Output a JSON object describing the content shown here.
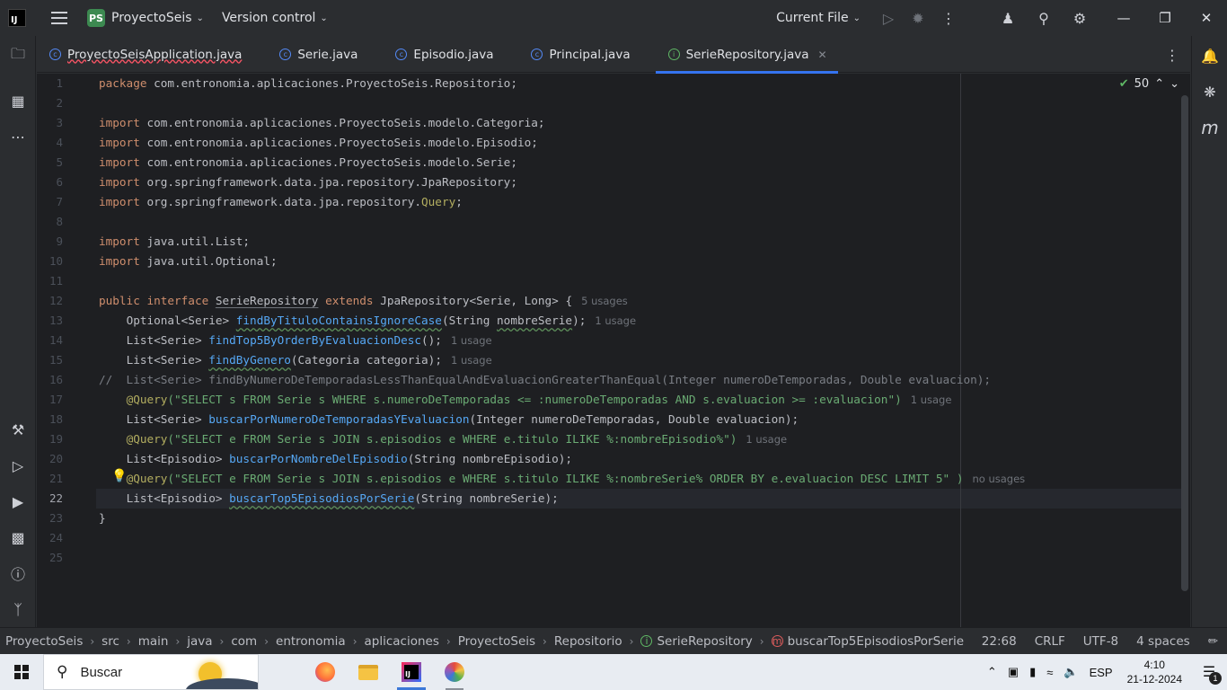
{
  "titlebar": {
    "app_logo": "IJ",
    "project_badge": "PS",
    "project_name": "ProyectoSeis",
    "vcs": "Version control",
    "run_config": "Current File"
  },
  "tabs": [
    {
      "label": "ProyectoSeisApplication.java",
      "kind": "class"
    },
    {
      "label": "Serie.java",
      "kind": "class"
    },
    {
      "label": "Episodio.java",
      "kind": "class"
    },
    {
      "label": "Principal.java",
      "kind": "class"
    },
    {
      "label": "SerieRepository.java",
      "kind": "interface",
      "active": true
    }
  ],
  "editor": {
    "inspection_count": "50",
    "current_line": 22,
    "line_numbers": [
      "1",
      "2",
      "3",
      "4",
      "5",
      "6",
      "7",
      "8",
      "9",
      "10",
      "11",
      "12",
      "13",
      "14",
      "15",
      "16",
      "17",
      "18",
      "19",
      "20",
      "21",
      "22",
      "23",
      "24",
      "25"
    ],
    "hints": {
      "l12": "5 usages",
      "l13": "1 usage",
      "l14": "1 usage",
      "l15": "1 usage",
      "l17": "1 usage",
      "l19": "1 usage",
      "l21": "no usages"
    },
    "code": {
      "l1_kw": "package",
      "l1_rest": " com.entronomia.aplicaciones.ProyectoSeis.Repositorio;",
      "l3": "com.entronomia.aplicaciones.ProyectoSeis.modelo.Categoria;",
      "l4": "com.entronomia.aplicaciones.ProyectoSeis.modelo.Episodio;",
      "l5": "com.entronomia.aplicaciones.ProyectoSeis.modelo.Serie;",
      "l6": "org.springframework.data.jpa.repository.JpaRepository;",
      "l7a": "org.springframework.data.jpa.repository.",
      "l7b": "Query",
      "l9": "java.util.List;",
      "l10": "java.util.Optional;",
      "import_kw": "import",
      "l12_kw1": "public interface",
      "l12_name": "SerieRepository",
      "l12_kw2": "extends",
      "l12_rest": "JpaRepository<Serie, Long> {",
      "l13a": "Optional<Serie> ",
      "l13fn": "findByTituloContainsIgnoreCase",
      "l13b": "(String ",
      "l13p": "nombreSerie",
      "l13c": ");",
      "l14a": "List<Serie> ",
      "l14fn": "findTop5ByOrderByEvaluacionDesc",
      "l14b": "();",
      "l15a": "List<Serie> ",
      "l15fn": "findByGenero",
      "l15b": "(Categoria categoria);",
      "l16": "//  List<Serie> findByNumeroDeTemporadasLessThanEqualAndEvaluacionGreaterThanEqual(Integer numeroDeTemporadas, Double evaluacion);",
      "l17ann": "@Query",
      "l17str": "(\"SELECT s FROM Serie s WHERE s.numeroDeTemporadas <= :numeroDeTemporadas AND s.evaluacion >= :evaluacion\")",
      "l18a": "List<Serie> ",
      "l18fn": "buscarPorNumeroDeTemporadasYEvaluacion",
      "l18b": "(Integer numeroDeTemporadas, Double evaluacion);",
      "l19ann": "@Query",
      "l19str": "(\"SELECT e FROM Serie s JOIN s.episodios e WHERE e.titulo ILIKE %:nombreEpisodio%\")",
      "l20a": "List<Episodio> ",
      "l20fn": "buscarPorNombreDelEpisodio",
      "l20b": "(String nombreEpisodio);",
      "l21ann": "@Query",
      "l21str": "(\"SELECT e FROM Serie s JOIN s.episodios e WHERE s.titulo ILIKE %:nombreSerie% ORDER BY e.evaluacion DESC LIMIT 5\" )",
      "l22a": "List<Episodio> ",
      "l22fn": "buscarTop5EpisodiosPorSerie",
      "l22b": "(String nombreSerie);",
      "l23": "}"
    }
  },
  "breadcrumb": [
    "ProyectoSeis",
    "src",
    "main",
    "java",
    "com",
    "entronomia",
    "aplicaciones",
    "ProyectoSeis",
    "Repositorio",
    "SerieRepository",
    "buscarTop5EpisodiosPorSerie"
  ],
  "statusbar": {
    "position": "22:68",
    "line_sep": "CRLF",
    "encoding": "UTF-8",
    "indent": "4 spaces"
  },
  "taskbar": {
    "search_placeholder": "Buscar",
    "lang": "ESP",
    "time": "4:10",
    "date": "21-12-2024",
    "notif_count": "1"
  },
  "colors": {
    "accent": "#3574f0",
    "keyword": "#cf8e6d",
    "string": "#6aab73",
    "annotation": "#b3ae60",
    "method": "#56a8f5"
  }
}
